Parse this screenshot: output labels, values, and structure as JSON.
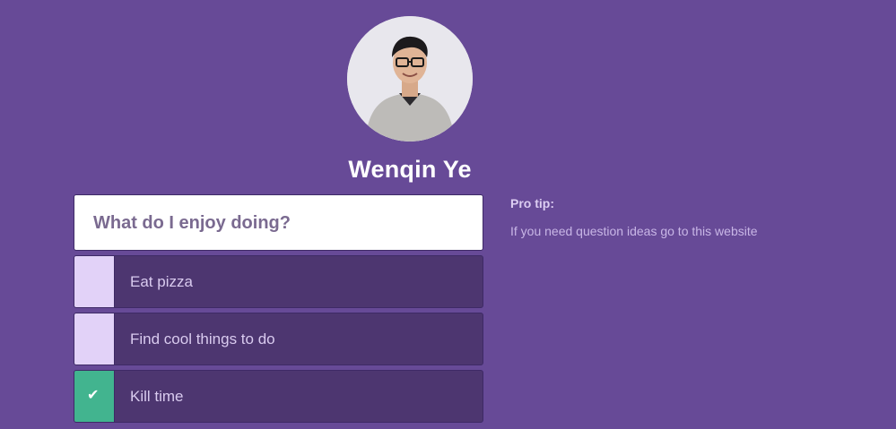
{
  "profile": {
    "name": "Wenqin Ye",
    "avatar_icon": "profile-photo"
  },
  "quiz": {
    "question": "What do I enjoy doing?",
    "answers": [
      {
        "label": "Eat pizza",
        "checked": false
      },
      {
        "label": "Find cool things to do",
        "checked": false
      },
      {
        "label": "Kill time",
        "checked": true
      }
    ],
    "check_glyph": "✔"
  },
  "tip": {
    "title": "Pro tip:",
    "body": "If you need question ideas go to this website"
  },
  "colors": {
    "background": "#674a97",
    "answer_bg": "#4d3670",
    "checkbox_unchecked": "#e2d2f8",
    "checkbox_checked": "#42b48f"
  }
}
